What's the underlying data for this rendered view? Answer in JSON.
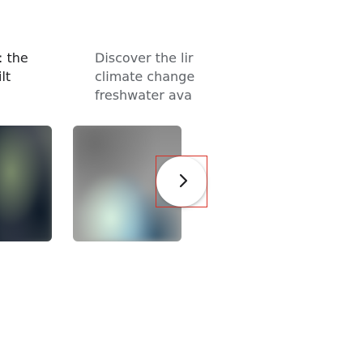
{
  "left_text": {
    "lines": [
      ": the",
      "ilt"
    ]
  },
  "right_text": {
    "lines": [
      "Discover the lir",
      "climate change",
      "freshwater ava"
    ]
  },
  "carousel": {
    "next_icon": "chevron-right-icon"
  },
  "colors": {
    "text_primary": "#202124",
    "text_secondary": "#5f6368",
    "focus_outline": "#d93025"
  }
}
